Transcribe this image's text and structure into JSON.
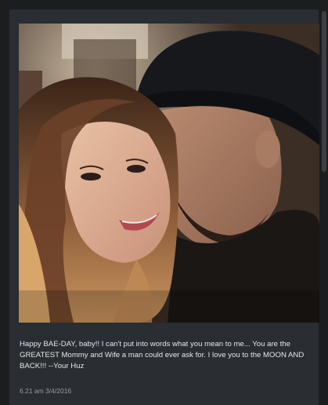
{
  "post": {
    "photo": {
      "subject": "selfie-couple-kiss",
      "accent_colors": {
        "background": "#1b1d1f",
        "card": "#2a2d31",
        "text": "#e7e7e7",
        "timestamp": "#9a9da1"
      }
    },
    "caption": "Happy BAE-DAY, baby!! I can't put into words what you mean to me... You are the GREATEST Mommy and Wife a man could ever ask for. I love you to the MOON AND BACK!!! --Your Huz",
    "timestamp": "6.21 am 3/4/2016"
  }
}
